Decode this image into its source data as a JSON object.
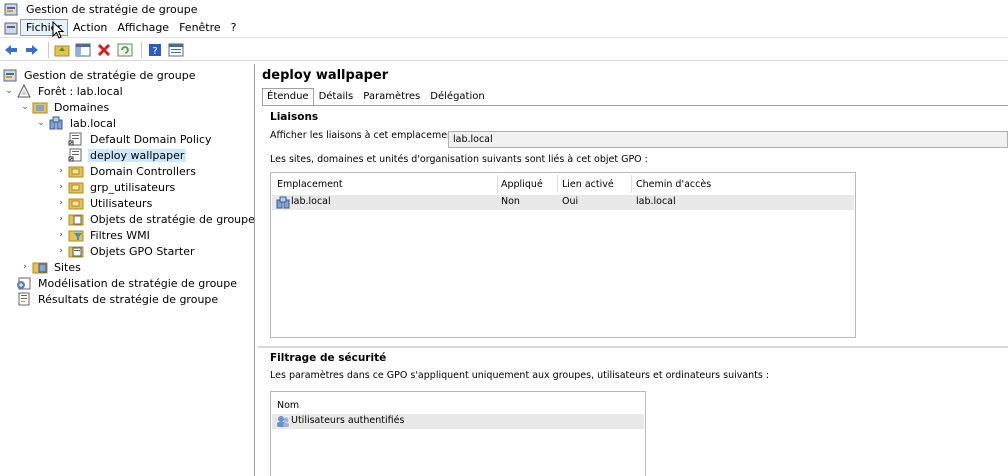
{
  "window": {
    "title": "Gestion de stratégie de groupe"
  },
  "menu": [
    "Fichier",
    "Action",
    "Affichage",
    "Fenêtre",
    "?"
  ],
  "toolbar_icons": [
    "back-icon",
    "forward-icon",
    "up-folder-icon",
    "show-hide-tree-icon",
    "delete-icon",
    "refresh-icon",
    "help-icon",
    "properties-icon"
  ],
  "tree": {
    "root": "Gestion de stratégie de groupe",
    "forest": "Forêt : lab.local",
    "domains": "Domaines",
    "domain": "lab.local",
    "items": [
      "Default Domain Policy",
      "deploy wallpaper",
      "Domain Controllers",
      "grp_utilisateurs",
      "Utilisateurs",
      "Objets de stratégie de groupe",
      "Filtres WMI",
      "Objets GPO Starter"
    ],
    "sites": "Sites",
    "modeling": "Modélisation de stratégie de groupe",
    "results": "Résultats de stratégie de groupe"
  },
  "detail": {
    "title": "deploy wallpaper",
    "tabs": [
      "Étendue",
      "Détails",
      "Paramètres",
      "Délégation"
    ],
    "links": {
      "heading": "Liaisons",
      "show_links_label": "Afficher les liaisons à cet emplacement :",
      "show_links_value": "lab.local",
      "description": "Les sites, domaines et unités d'organisation suivants sont liés à cet objet GPO :",
      "columns": [
        "Emplacement",
        "Appliqué",
        "Lien activé",
        "Chemin d'accès"
      ],
      "rows": [
        {
          "location": "lab.local",
          "enforced": "Non",
          "enabled": "Oui",
          "path": "lab.local"
        }
      ]
    },
    "security": {
      "heading": "Filtrage de sécurité",
      "description": "Les paramètres dans ce GPO s'appliquent uniquement aux groupes, utilisateurs et ordinateurs suivants :",
      "columns": [
        "Nom"
      ],
      "rows": [
        "Utilisateurs authentifiés"
      ]
    }
  },
  "colors": {
    "selection": "#cce8ff",
    "folder": "#e8c24a",
    "delete": "#d21f1f"
  }
}
